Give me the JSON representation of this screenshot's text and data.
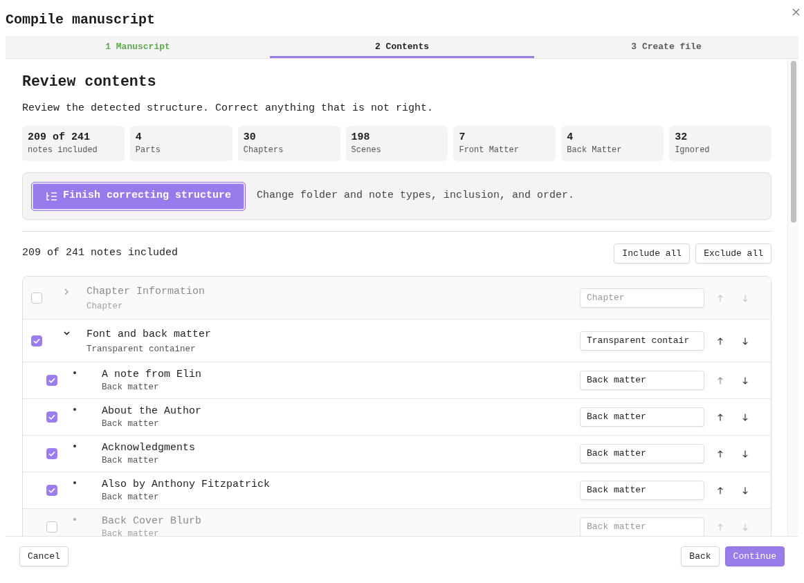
{
  "dialog": {
    "title": "Compile manuscript"
  },
  "tabs": [
    {
      "label": "1 Manuscript",
      "selected": false,
      "done": true
    },
    {
      "label": "2 Contents",
      "selected": true,
      "done": false
    },
    {
      "label": "3 Create file",
      "selected": false,
      "done": false
    }
  ],
  "content": {
    "heading": "Review contents",
    "description": "Review the detected structure. Correct anything that is not right.",
    "stats": [
      {
        "value": "209 of 241",
        "label": "notes included"
      },
      {
        "value": "4",
        "label": "Parts"
      },
      {
        "value": "30",
        "label": "Chapters"
      },
      {
        "value": "198",
        "label": "Scenes"
      },
      {
        "value": "7",
        "label": "Front Matter"
      },
      {
        "value": "4",
        "label": "Back Matter"
      },
      {
        "value": "32",
        "label": "Ignored"
      }
    ],
    "callout": {
      "button": "Finish correcting structure",
      "text": "Change folder and note types, inclusion, and order."
    },
    "summary": "209 of 241 notes included",
    "actions": [
      "Include all",
      "Exclude all"
    ],
    "notes": [
      {
        "kind": "folder",
        "title": "Chapter Information",
        "subtitle": "Chapter",
        "included": false,
        "expanded": false,
        "type_value": "Chapter",
        "up_disabled": false
      },
      {
        "kind": "folder",
        "title": "Font and back matter",
        "subtitle": "Transparent container",
        "included": true,
        "expanded": true,
        "type_value": "Transparent contair",
        "up_disabled": false,
        "children": [
          {
            "kind": "note",
            "title": "A note from Elin",
            "subtitle": "Back matter",
            "included": true,
            "type_value": "Back matter",
            "up_disabled": true
          },
          {
            "kind": "note",
            "title": "About the Author",
            "subtitle": "Back matter",
            "included": true,
            "type_value": "Back matter",
            "up_disabled": false
          },
          {
            "kind": "note",
            "title": "Acknowledgments",
            "subtitle": "Back matter",
            "included": true,
            "type_value": "Back matter",
            "up_disabled": false
          },
          {
            "kind": "note",
            "title": "Also by Anthony Fitzpatrick",
            "subtitle": "Back matter",
            "included": true,
            "type_value": "Back matter",
            "up_disabled": false
          },
          {
            "kind": "note",
            "title": "Back Cover Blurb",
            "subtitle": "Back matter",
            "included": false,
            "type_value": "Back matter",
            "up_disabled": false
          }
        ]
      }
    ]
  },
  "footer": {
    "cancel": "Cancel",
    "back": "Back",
    "continue": "Continue"
  }
}
